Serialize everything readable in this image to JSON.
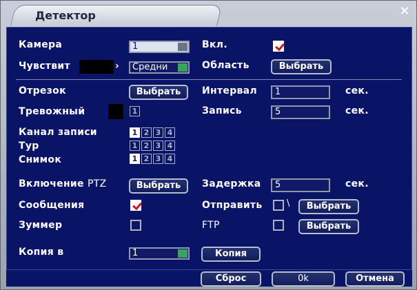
{
  "window": {
    "title": "Детектор",
    "close_glyph": "×"
  },
  "rows": {
    "camera": {
      "label": "Камера",
      "value": "1"
    },
    "enable": {
      "label": "Вкл.",
      "checked": true
    },
    "sensitivity": {
      "label": "Чувствит",
      "value": "Средни"
    },
    "area": {
      "label": "Область",
      "button": "Выбрать"
    },
    "period": {
      "label": "Отрезок",
      "button": "Выбрать"
    },
    "interval": {
      "label": "Интервал",
      "value": "1",
      "unit": "сек."
    },
    "alarm_out": {
      "label": "Тревожный",
      "value": "1"
    },
    "record": {
      "label": "Запись",
      "value": "5",
      "unit": "сек."
    },
    "record_channel": {
      "label": "Канал записи",
      "channels": [
        "1",
        "2",
        "3",
        "4"
      ],
      "active": [
        "1"
      ]
    },
    "tour": {
      "label": "Тур",
      "channels": [
        "1",
        "2",
        "3",
        "4"
      ],
      "active": []
    },
    "snapshot": {
      "label": "Снимок",
      "channels": [
        "1",
        "2",
        "3",
        "4"
      ],
      "active": [
        "1"
      ]
    },
    "ptz": {
      "label_main": "Включение",
      "label_ptz": "PTZ",
      "button": "Выбрать"
    },
    "delay": {
      "label": "Задержка",
      "value": "5",
      "unit": "сек."
    },
    "messages": {
      "label": "Сообщения",
      "checked": true
    },
    "send": {
      "label": "Отправить",
      "glyph": "\\",
      "button": "Выбрать"
    },
    "buzzer": {
      "label": "Зуммер",
      "checked": false
    },
    "ftp": {
      "label": "FTP",
      "button": "Выбрать"
    },
    "copy": {
      "label": "Копия в",
      "value": "1",
      "button": "Копия"
    }
  },
  "footer": {
    "reset": "Сброс",
    "ok": "0k",
    "cancel": "Отмена"
  }
}
